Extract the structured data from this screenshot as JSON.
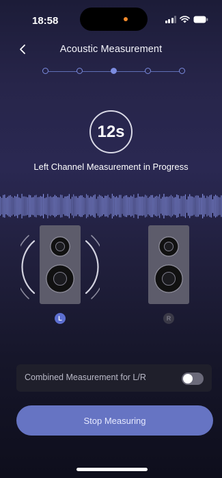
{
  "status_bar": {
    "time": "18:58",
    "signal_icon": "cellular-signal-icon",
    "wifi_icon": "wifi-icon",
    "battery_icon": "battery-icon"
  },
  "nav": {
    "title": "Acoustic Measurement",
    "back_icon": "chevron-left-icon"
  },
  "stepper": {
    "total_steps": 5,
    "current_step": 3
  },
  "timer": {
    "text": "12s"
  },
  "status_text": "Left Channel Measurement in Progress",
  "speakers": {
    "left_label": "L",
    "right_label": "R",
    "active_channel": "L"
  },
  "combined_measurement": {
    "label": "Combined Measurement for L/R",
    "enabled": false
  },
  "stop_button": {
    "label": "Stop Measuring"
  },
  "colors": {
    "accent": "#7c8ce0",
    "button": "#6674c3",
    "waveform": "#8f9cf2",
    "background_top": "#1c1c38",
    "background_bottom": "#0e0e1c"
  }
}
